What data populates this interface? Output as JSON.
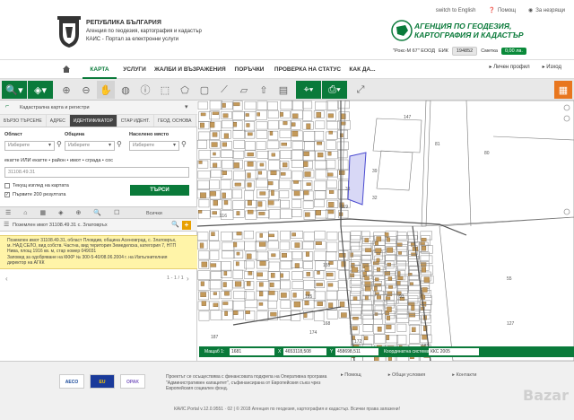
{
  "header": {
    "line1": "РЕПУБЛИКА БЪЛГАРИЯ",
    "line2": "Агенция по геодезия, картография и кадастър",
    "line3": "КАИС - Портал за електронни услуги",
    "top_links": {
      "lang": "switch to English",
      "help": "Помощ",
      "favorite": "За незрящи"
    },
    "agency_name_1": "АГЕНЦИЯ ПО ГЕОДЕЗИЯ,",
    "agency_name_2": "КАРТОГРАФИЯ И КАДАСТЪР",
    "company": "\"Рокс-М 67\" ЕООД",
    "eik_label": "ЕИК",
    "eik_value": "194852",
    "amount_label": "Сметка",
    "amount_value": "0,00 лв."
  },
  "nav": {
    "items": [
      {
        "label": "КАРТА",
        "active": true
      },
      {
        "label": "УСЛУГИ",
        "active": false
      },
      {
        "label": "ЖАЛБИ И ВЪЗРАЖЕНИЯ",
        "active": false
      },
      {
        "label": "ПОРЪЧКИ",
        "active": false
      },
      {
        "label": "ПРОВЕРКА НА СТАТУС",
        "active": false
      },
      {
        "label": "КАК ДА...",
        "active": false
      }
    ],
    "profile": "Личен профил",
    "logout": "Изход"
  },
  "panel": {
    "layer_select": "Кадастрална карта и регистри",
    "tabs": [
      "БЪРЗО ТЪРСЕНЕ",
      "АДРЕС",
      "ИДЕНТИФИКАТОР",
      "СТАР ИДЕНТ.",
      "ГЕОД. ОСНОВА"
    ],
    "active_tab": 2,
    "region_label": "Област",
    "municipality_label": "Община",
    "settlement_label": "Населено място",
    "region_placeholder": "Изберете",
    "municipality_placeholder": "Изберете",
    "settlement_placeholder": "Изберете",
    "input_label": "екатте ИЛИ екатте • район • имот • сграда • соc",
    "input_value": "31108.49.31",
    "check_current_view": "Текущ изглед на картата",
    "check_first_200": "Първите 200 резултата",
    "search_button": "ТЪРСИ",
    "results_all": "Всички",
    "result_header": "Поземлен имот 31108.49.31 с. Златовръх",
    "result_text_1": "Поземлен имот 31108.49.31, област Пловдив, община Асеновград, с. Златовръх,",
    "result_text_2": "м. НАД СЕЛО, вид собств. Частна, вид територия Земеделска, категория 7, НТП",
    "result_text_3": "Нива, площ 1916 кв. м, стар номер 049031",
    "result_text_4": "Заповед за одобряване на КККР № 300-5-40/08.06.2004 г. на Изпълнителния",
    "result_text_5": "директор на АГКК",
    "pager_text": "1 - 1 / 1"
  },
  "map_bar": {
    "scale_label": "Мащаб 1:",
    "scale_value": "1681",
    "x_value": "4653118,508",
    "y_value": "458698,511",
    "crs_label": "Координатна система",
    "crs_value": "ККС 2005"
  },
  "map_labels": [
    {
      "t": "147"
    },
    {
      "t": "81"
    },
    {
      "t": "80"
    },
    {
      "t": "32"
    },
    {
      "t": "31"
    },
    {
      "t": "39"
    },
    {
      "t": "119"
    },
    {
      "t": "116"
    },
    {
      "t": "155"
    },
    {
      "t": "168"
    },
    {
      "t": "172"
    },
    {
      "t": "176"
    },
    {
      "t": "180"
    },
    {
      "t": "174"
    },
    {
      "t": "181"
    },
    {
      "t": "93"
    },
    {
      "t": "185"
    },
    {
      "t": "187"
    },
    {
      "t": "127"
    },
    {
      "t": "55"
    }
  ],
  "footer": {
    "text_1": "Проектът се осъществява с финансовата подкрепа на Оперативна програма",
    "text_2": "\"Административен капацитет\", съфинансирана от Европейския съюз чрез",
    "text_3": "Европейския социален фонд.",
    "links": [
      "Помощ",
      "Общи условия",
      "Контакти"
    ],
    "copyright": "КАИС.Portal v.12.0.9551 · 02 | © 2018 Агенция по геодезия, картография и кадастър. Всички права запазени!",
    "logo_1": "AECO",
    "logo_2": "EU",
    "logo_3": "OPAK",
    "watermark": "Bazar"
  },
  "colors": {
    "brand_green": "#0a7a3a",
    "parcel_brown": "#c49a5a",
    "highlight_blue": "#4a4ad0",
    "result_yellow": "#fff4a8"
  }
}
